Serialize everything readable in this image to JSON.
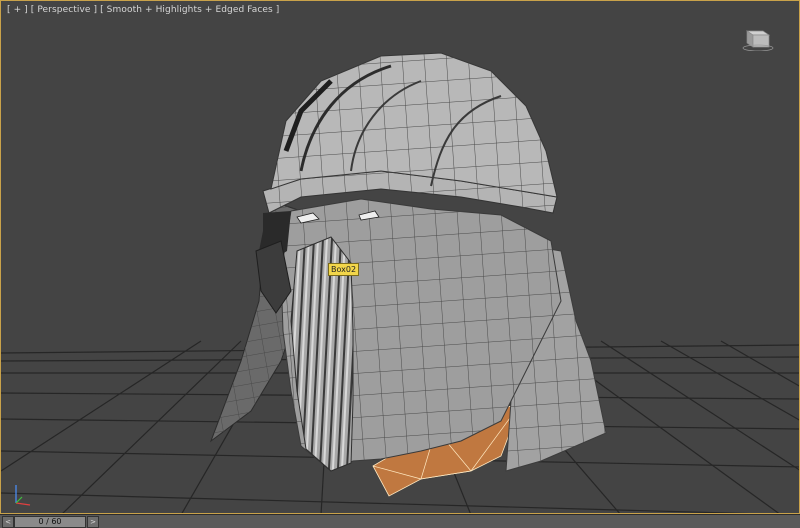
{
  "viewport": {
    "plus_menu": "[ + ]",
    "view_menu": "[ Perspective ]",
    "shading_menu": "[ Smooth + Highlights + Edged Faces ]",
    "object_label": "Box02",
    "active_border_color": "#c9a24a",
    "background_color": "#444444",
    "viewcube_icon": "viewcube-icon",
    "axis_icon": "axis-tripod-icon"
  },
  "timeslider": {
    "frame_readout": "0 / 60",
    "left_arrow": "<",
    "right_arrow": ">"
  },
  "colors": {
    "mesh": "#9a9a9a",
    "mesh_light": "#bdbdbd",
    "mesh_dark": "#5e5e5e",
    "inner_fill": "#c07840",
    "grid": "#2a2a2a"
  }
}
